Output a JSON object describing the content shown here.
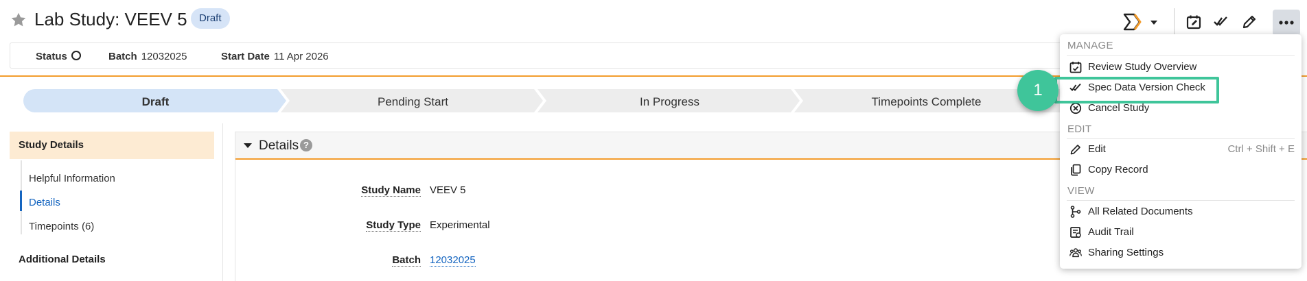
{
  "header": {
    "title": "Lab Study: VEEV 5",
    "badge": "Draft"
  },
  "statusbar": {
    "status_label": "Status",
    "batch_label": "Batch",
    "batch_value": "12032025",
    "start_label": "Start Date",
    "start_value": "11 Apr 2026"
  },
  "lifecycle": {
    "stages": [
      "Draft",
      "Pending Start",
      "In Progress",
      "Timepoints Complete"
    ],
    "current": "Draft"
  },
  "leftnav": {
    "sections": [
      {
        "label": "Study Details",
        "items": [
          "Helpful Information",
          "Details",
          "Timepoints (6)"
        ]
      },
      {
        "label": "Additional Details"
      }
    ],
    "selected_item": "Details"
  },
  "details": {
    "title": "Details",
    "help": "?",
    "fields": [
      {
        "label": "Study Name",
        "value": "VEEV 5"
      },
      {
        "label": "Study Type",
        "value": "Experimental"
      },
      {
        "label": "Batch",
        "value": "12032025"
      }
    ]
  },
  "menu": {
    "groups": [
      {
        "heading": "MANAGE",
        "items": [
          {
            "label": "Review Study Overview",
            "icon": "calendar-check-icon"
          },
          {
            "label": "Spec Data Version Check",
            "icon": "double-check-icon"
          },
          {
            "label": "Cancel Study",
            "icon": "circle-x-icon"
          }
        ]
      },
      {
        "heading": "EDIT",
        "items": [
          {
            "label": "Edit",
            "icon": "pencil-icon",
            "shortcut": "Ctrl + Shift + E"
          },
          {
            "label": "Copy Record",
            "icon": "copy-icon"
          }
        ]
      },
      {
        "heading": "VIEW",
        "items": [
          {
            "label": "All Related Documents",
            "icon": "branch-icon"
          },
          {
            "label": "Audit Trail",
            "icon": "audit-trail-icon"
          },
          {
            "label": "Sharing Settings",
            "icon": "people-icon"
          }
        ]
      }
    ]
  },
  "callout": {
    "number": "1"
  },
  "colors": {
    "accent_orange": "#f39c2c",
    "current_stage": "#d4e4f7",
    "stage_bg": "#ededed",
    "link_blue": "#1565c0",
    "callout_green": "#3fc59a",
    "nav_active": "#fdebd3"
  }
}
